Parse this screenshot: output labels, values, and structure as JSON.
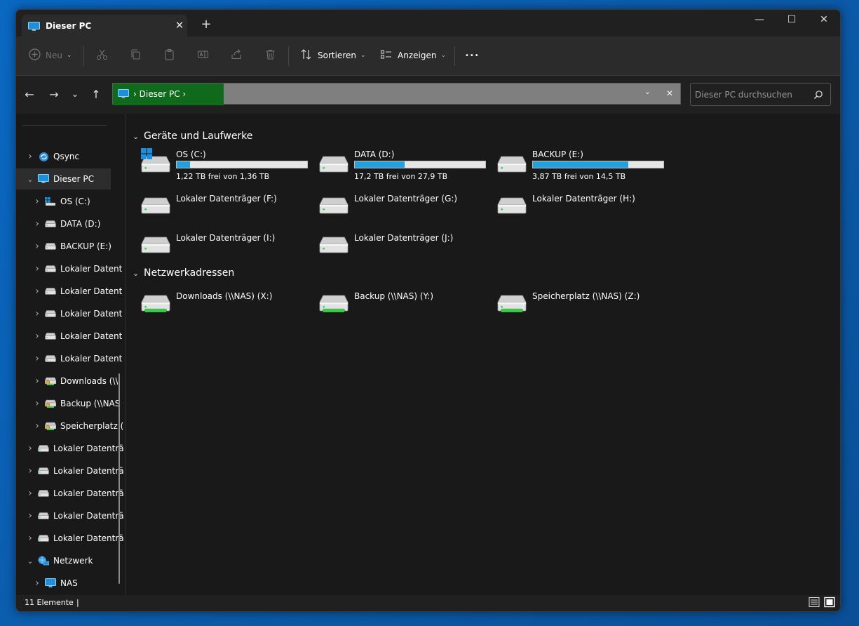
{
  "window": {
    "tab_title": "Dieser PC",
    "newtab_glyph": "+",
    "close_tab_glyph": "✕",
    "min_glyph": "—",
    "max_glyph": "☐",
    "close_glyph": "✕"
  },
  "toolbar": {
    "new_label": "Neu",
    "sort_label": "Sortieren",
    "view_label": "Anzeigen",
    "more_glyph": "•••",
    "icons": [
      "cut-icon",
      "copy-icon",
      "paste-icon",
      "rename-icon",
      "share-icon",
      "delete-icon"
    ]
  },
  "nav": {
    "back_glyph": "←",
    "forward_glyph": "→",
    "recent_glyph": "⌄",
    "up_glyph": "↑",
    "breadcrumb": "›  Dieser PC  ›",
    "search_placeholder": "Dieser PC durchsuchen"
  },
  "sidebar": {
    "items": [
      {
        "label": "Qsync",
        "icon": "qsync-icon",
        "expanded": false
      },
      {
        "label": "Dieser PC",
        "icon": "pc-icon",
        "expanded": true,
        "selected": true
      },
      {
        "label": "OS (C:)",
        "icon": "os-drive-icon"
      },
      {
        "label": "DATA (D:)",
        "icon": "drive-icon"
      },
      {
        "label": "BACKUP (E:)",
        "icon": "drive-icon"
      },
      {
        "label": "Lokaler Datent",
        "icon": "drive-icon"
      },
      {
        "label": "Lokaler Datent",
        "icon": "drive-icon"
      },
      {
        "label": "Lokaler Datent",
        "icon": "drive-icon"
      },
      {
        "label": "Lokaler Datent",
        "icon": "drive-icon"
      },
      {
        "label": "Lokaler Datent",
        "icon": "drive-icon"
      },
      {
        "label": "Downloads (\\\\",
        "icon": "network-drive-icon"
      },
      {
        "label": "Backup (\\\\NAS",
        "icon": "network-drive-icon"
      },
      {
        "label": "Speicherplatz (",
        "icon": "network-drive-icon"
      },
      {
        "label": "Lokaler Datenträ",
        "icon": "drive-icon"
      },
      {
        "label": "Lokaler Datenträ",
        "icon": "drive-icon"
      },
      {
        "label": "Lokaler Datenträ",
        "icon": "drive-icon"
      },
      {
        "label": "Lokaler Datenträ",
        "icon": "drive-icon"
      },
      {
        "label": "Lokaler Datenträ",
        "icon": "drive-icon"
      },
      {
        "label": "Netzwerk",
        "icon": "network-icon",
        "expanded": true
      },
      {
        "label": "NAS",
        "icon": "pc-icon"
      }
    ]
  },
  "content": {
    "group_devices": "Geräte und Laufwerke",
    "group_network": "Netzwerkadressen",
    "drives": [
      {
        "name": "OS (C:)",
        "free": "1,22 TB frei von 1,36 TB",
        "used_fraction": 0.1
      },
      {
        "name": "DATA (D:)",
        "free": "17,2 TB frei von 27,9 TB",
        "used_fraction": 0.38
      },
      {
        "name": "BACKUP (E:)",
        "free": "3,87 TB frei von 14,5 TB",
        "used_fraction": 0.73
      },
      {
        "name": "Lokaler Datenträger (F:)"
      },
      {
        "name": "Lokaler Datenträger (G:)"
      },
      {
        "name": "Lokaler Datenträger (H:)"
      },
      {
        "name": "Lokaler Datenträger (I:)"
      },
      {
        "name": "Lokaler Datenträger (J:)"
      }
    ],
    "network": [
      {
        "name": "Downloads (\\\\NAS) (X:)"
      },
      {
        "name": "Backup (\\\\NAS) (Y:)"
      },
      {
        "name": "Speicherplatz (\\\\NAS) (Z:)"
      }
    ]
  },
  "status": {
    "count": "11 Elemente",
    "cursor": "|"
  },
  "colors": {
    "accent": "#26a0da",
    "address_highlight": "#0f6b1b"
  }
}
